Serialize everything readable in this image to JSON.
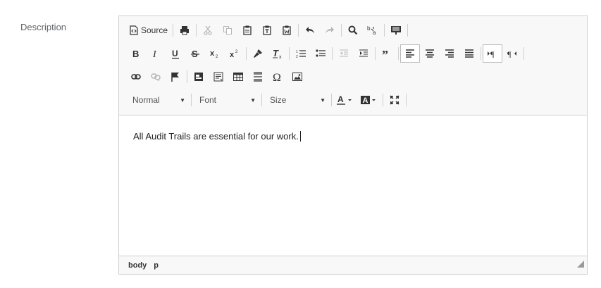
{
  "field": {
    "label": "Description"
  },
  "toolbar": {
    "source_label": "Source",
    "combos": {
      "format": "Normal",
      "font": "Font",
      "size": "Size"
    }
  },
  "content": {
    "text": "All Audit Trails are essential for our work."
  },
  "statusbar": {
    "path": [
      "body",
      "p"
    ]
  },
  "icons": [
    "source-icon",
    "print-icon",
    "cut-icon",
    "copy-icon",
    "paste-icon",
    "paste-text-icon",
    "paste-word-icon",
    "undo-icon",
    "redo-icon",
    "find-icon",
    "replace-icon",
    "templates-icon",
    "bold-icon",
    "italic-icon",
    "underline-icon",
    "strike-icon",
    "subscript-icon",
    "superscript-icon",
    "copy-formatting-icon",
    "remove-format-icon",
    "numbered-list-icon",
    "bulleted-list-icon",
    "outdent-icon",
    "indent-icon",
    "blockquote-icon",
    "align-left-icon",
    "align-center-icon",
    "align-right-icon",
    "justify-icon",
    "ltr-icon",
    "rtl-icon",
    "link-icon",
    "unlink-icon",
    "anchor-icon",
    "form-icon",
    "textarea-icon",
    "table-icon",
    "horizontal-rule-icon",
    "special-char-icon",
    "image-icon",
    "text-color-icon",
    "background-color-icon",
    "maximize-icon",
    "resize-icon"
  ]
}
